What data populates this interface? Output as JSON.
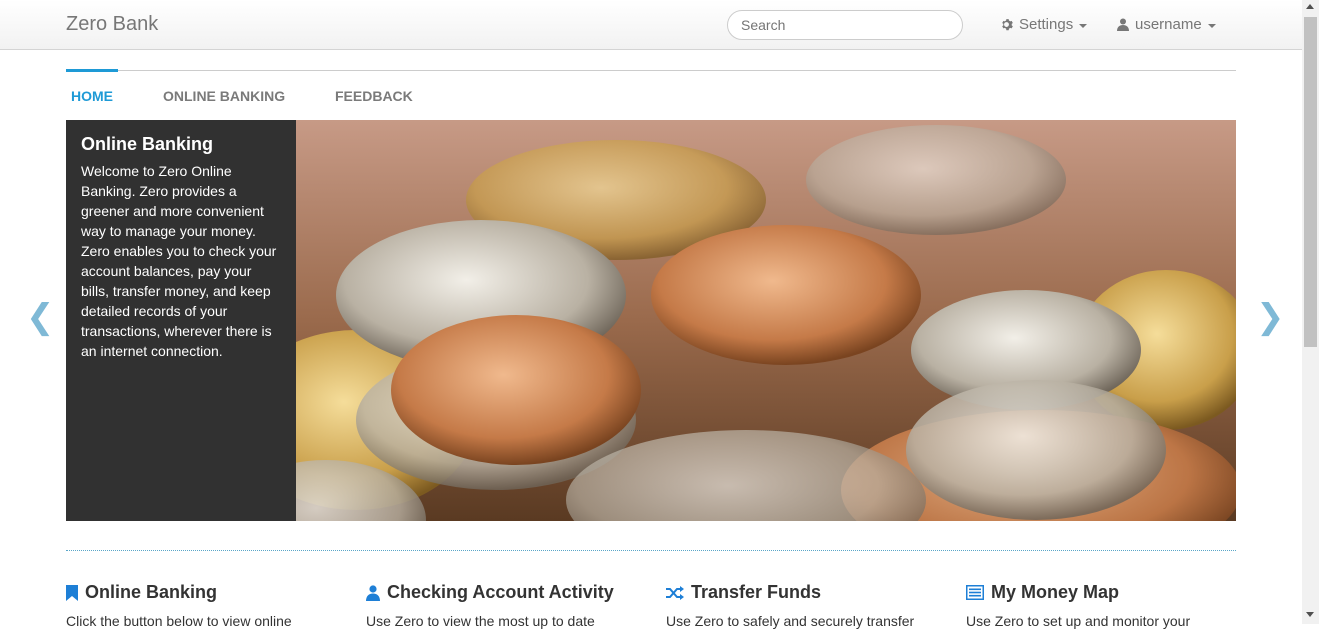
{
  "header": {
    "brand": "Zero Bank",
    "search_placeholder": "Search",
    "settings_label": "Settings",
    "user_label": "username"
  },
  "tabs": [
    {
      "label": "HOME",
      "active": true
    },
    {
      "label": "ONLINE BANKING",
      "active": false
    },
    {
      "label": "FEEDBACK",
      "active": false
    }
  ],
  "hero": {
    "title": "Online Banking",
    "text": "Welcome to Zero Online Banking. Zero provides a greener and more convenient way to manage your money. Zero enables you to check your account balances, pay your bills, transfer money, and keep detailed records of your transactions, wherever there is an internet connection.",
    "prev_arrow": "❮",
    "next_arrow": "❯"
  },
  "features": [
    {
      "icon": "bookmark-icon",
      "title": "Online Banking",
      "text": "Click the button below to view online"
    },
    {
      "icon": "user-icon",
      "title": "Checking Account Activity",
      "text": "Use Zero to view the most up to date"
    },
    {
      "icon": "shuffle-icon",
      "title": "Transfer Funds",
      "text": "Use Zero to safely and securely transfer"
    },
    {
      "icon": "list-alt-icon",
      "title": "My Money Map",
      "text": "Use Zero to set up and monitor your"
    }
  ],
  "colors": {
    "accent": "#1e9ad6",
    "caption_bg": "#313131"
  }
}
